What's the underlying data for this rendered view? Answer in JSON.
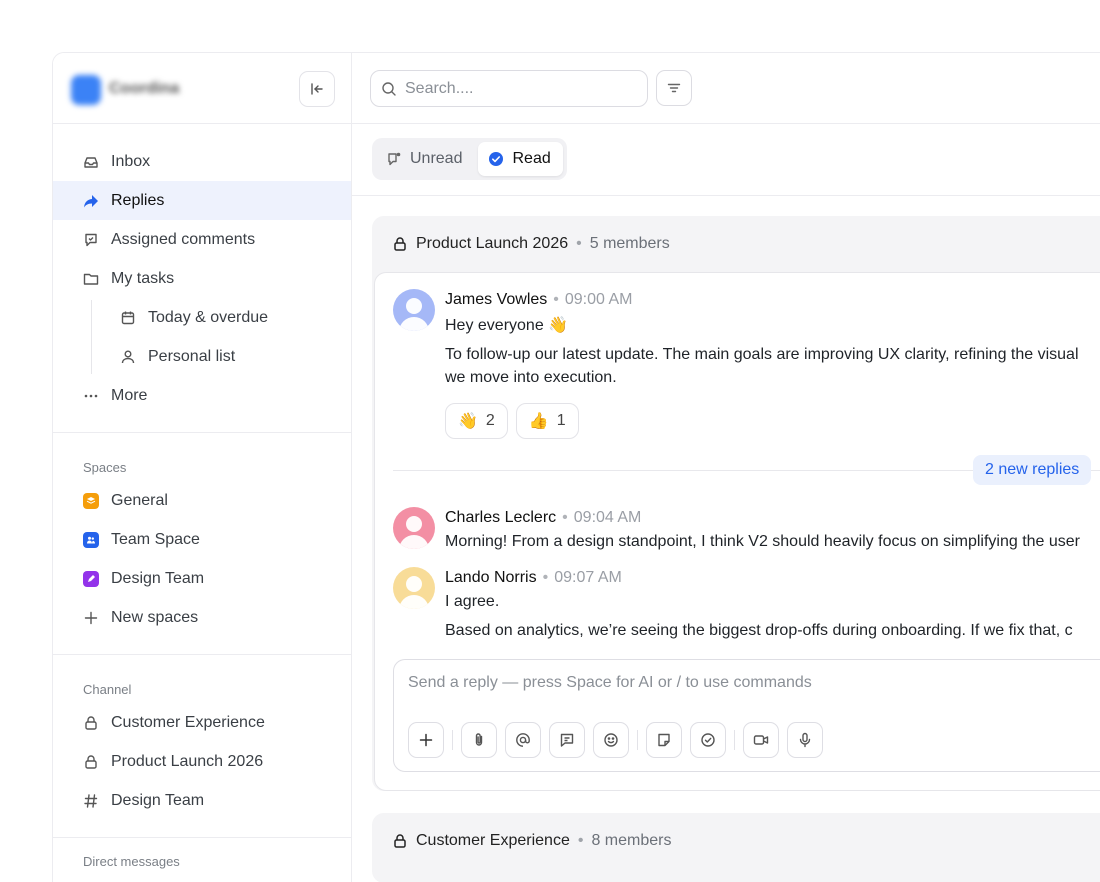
{
  "workspace": {
    "name": "Coordina"
  },
  "search": {
    "placeholder": "Search...."
  },
  "sidebar": {
    "nav": [
      {
        "label": "Inbox",
        "icon": "inbox-icon"
      },
      {
        "label": "Replies",
        "icon": "reply-arrow-icon",
        "active": true
      },
      {
        "label": "Assigned comments",
        "icon": "comment-icon"
      },
      {
        "label": "My tasks",
        "icon": "folder-icon"
      }
    ],
    "tasks_sub": [
      {
        "label": "Today & overdue",
        "icon": "calendar-icon"
      },
      {
        "label": "Personal list",
        "icon": "user-icon"
      }
    ],
    "more_label": "More",
    "spaces_title": "Spaces",
    "spaces": [
      {
        "label": "General",
        "color": "#f59e0b"
      },
      {
        "label": "Team Space",
        "color": "#2563eb"
      },
      {
        "label": "Design Team",
        "color": "#9333ea"
      }
    ],
    "new_space_label": "New spaces",
    "channel_title": "Channel",
    "channels": [
      {
        "label": "Customer Experience",
        "icon": "lock-icon"
      },
      {
        "label": "Product Launch 2026",
        "icon": "lock-icon"
      },
      {
        "label": "Design Team",
        "icon": "hash-icon"
      }
    ],
    "dm_title": "Direct messages"
  },
  "filters": {
    "unread_label": "Unread",
    "read_label": "Read",
    "selected": "Read"
  },
  "thread": {
    "title": "Product Launch 2026",
    "members": "5 members",
    "messages": [
      {
        "author": "James Vowles",
        "time": "09:00 AM",
        "avatar_color": "#a5b8f7",
        "lines": [
          "Hey everyone 👋",
          "To follow-up our latest update. The main goals are improving UX clarity, refining the visual",
          "we move into execution."
        ],
        "reactions": [
          {
            "emoji": "👋",
            "count": "2"
          },
          {
            "emoji": "👍",
            "count": "1"
          }
        ]
      }
    ],
    "new_replies": "2 new replies",
    "replies": [
      {
        "author": "Charles Leclerc",
        "time": "09:04 AM",
        "avatar_color": "#f38fa4",
        "lines": [
          "Morning! From a design standpoint, I think V2 should heavily focus on simplifying the user"
        ]
      },
      {
        "author": "Lando Norris",
        "time": "09:07 AM",
        "avatar_color": "#f8dc98",
        "lines": [
          "I agree.",
          "Based on analytics, we’re seeing the biggest drop-offs during onboarding. If we fix that, c"
        ]
      }
    ],
    "composer_placeholder": "Send a reply — press Space for AI or / to use commands"
  },
  "thread2": {
    "title": "Customer Experience",
    "members": "8 members"
  },
  "colors": {
    "accent": "#2563eb",
    "active_bg": "#eef2fd"
  }
}
